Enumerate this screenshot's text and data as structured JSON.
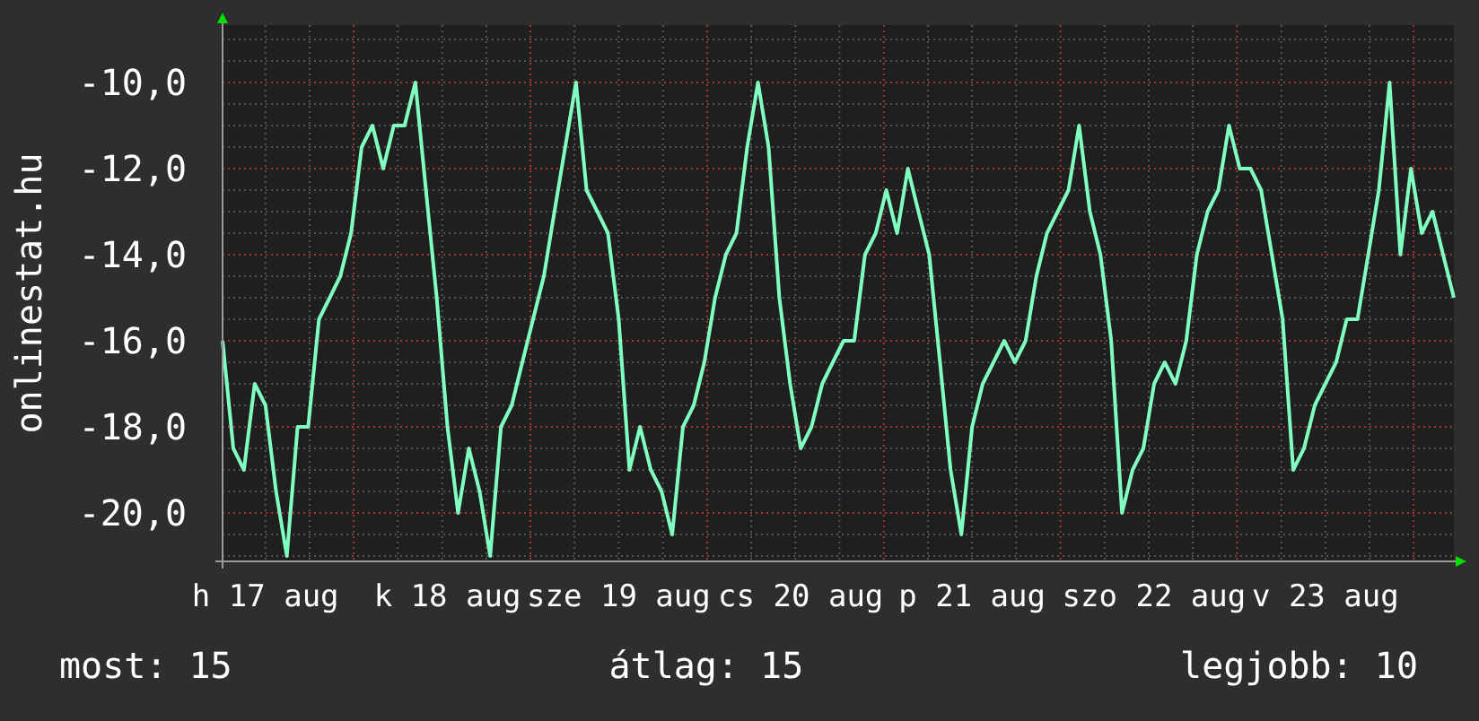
{
  "chart_data": {
    "type": "line",
    "ylabel": "onlinestat.hu",
    "grid": true,
    "ylim": [
      -21.125,
      -8.667
    ],
    "yticks": [
      {
        "value": -10,
        "label": "-10,0"
      },
      {
        "value": -12,
        "label": "-12,0"
      },
      {
        "value": -14,
        "label": "-14,0"
      },
      {
        "value": -16,
        "label": "-16,0"
      },
      {
        "value": -18,
        "label": "-18,0"
      },
      {
        "value": -20,
        "label": "-20,0"
      }
    ],
    "categories": [
      null,
      null,
      null,
      null,
      "h 17 aug",
      null,
      null,
      null,
      null,
      null,
      null,
      null,
      null,
      null,
      null,
      null,
      null,
      null,
      null,
      null,
      null,
      "k 18 aug",
      null,
      null,
      null,
      null,
      null,
      null,
      null,
      null,
      null,
      null,
      null,
      null,
      null,
      null,
      null,
      "sze 19 aug",
      null,
      null,
      null,
      null,
      null,
      null,
      null,
      null,
      null,
      null,
      null,
      null,
      null,
      null,
      null,
      null,
      "cs 20 aug",
      null,
      null,
      null,
      null,
      null,
      null,
      null,
      null,
      null,
      null,
      null,
      null,
      null,
      null,
      null,
      "p 21 aug",
      null,
      null,
      null,
      null,
      null,
      null,
      null,
      null,
      null,
      null,
      null,
      null,
      null,
      null,
      null,
      null,
      "szo 22 aug",
      null,
      null,
      null,
      null,
      null,
      null,
      null,
      null,
      null,
      null,
      null,
      null,
      null,
      null,
      null,
      "v 23 aug",
      null,
      null,
      null,
      null,
      null,
      null,
      null,
      null,
      null,
      null,
      null,
      null
    ],
    "series": [
      {
        "color": "#80ffc0",
        "values": [
          -16,
          -18.5,
          -19,
          -17,
          -17.5,
          -19.5,
          -21,
          -18,
          -18,
          -15.5,
          -15,
          -14.5,
          -13.5,
          -11.5,
          -11,
          -12,
          -11,
          -11,
          -10,
          -12.5,
          -15,
          -18,
          -20,
          -18.5,
          -19.5,
          -21,
          -18,
          -17.5,
          -16.5,
          -15.5,
          -14.5,
          -13,
          -11.5,
          -10,
          -12.5,
          -13,
          -13.5,
          -15.5,
          -19,
          -18,
          -19,
          -19.5,
          -20.5,
          -18,
          -17.5,
          -16.5,
          -15,
          -14,
          -13.5,
          -11.5,
          -10,
          -11.5,
          -15,
          -17,
          -18.5,
          -18,
          -17,
          -16.5,
          -16,
          -16,
          -14,
          -13.5,
          -12.5,
          -13.5,
          -12,
          -13,
          -14,
          -16.5,
          -19,
          -20.5,
          -18,
          -17,
          -16.5,
          -16,
          -16.5,
          -16,
          -14.5,
          -13.5,
          -13,
          -12.5,
          -11,
          -13,
          -14,
          -16,
          -20,
          -19,
          -18.5,
          -17,
          -16.5,
          -17,
          -16,
          -14,
          -13,
          -12.5,
          -11,
          -12,
          -12,
          -12.5,
          -14,
          -15.5,
          -19,
          -18.5,
          -17.5,
          -17,
          -16.5,
          -15.5,
          -15.5,
          -14,
          -12.5,
          -10,
          -14,
          -12,
          -13.5,
          -13,
          -14,
          -15
        ]
      }
    ]
  },
  "legend": [
    {
      "label": "most: 15"
    },
    {
      "label": "átlag: 15"
    },
    {
      "label": "legjobb: 10"
    }
  ]
}
